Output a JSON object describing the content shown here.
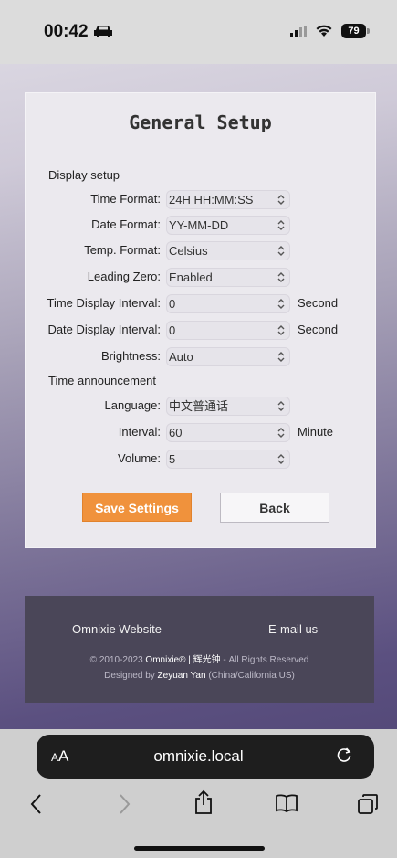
{
  "status_bar": {
    "time": "00:42",
    "battery": "79"
  },
  "panel": {
    "title": "General Setup",
    "display_section": "Display setup",
    "rows": [
      {
        "label": "Time Format:",
        "value": "24H HH:MM:SS",
        "unit": ""
      },
      {
        "label": "Date Format:",
        "value": "YY-MM-DD",
        "unit": ""
      },
      {
        "label": "Temp. Format:",
        "value": "Celsius",
        "unit": ""
      },
      {
        "label": "Leading Zero:",
        "value": "Enabled",
        "unit": ""
      },
      {
        "label": "Time Display Interval:",
        "value": "0",
        "unit": "Second"
      },
      {
        "label": "Date Display Interval:",
        "value": "0",
        "unit": "Second"
      },
      {
        "label": "Brightness:",
        "value": "Auto",
        "unit": ""
      }
    ],
    "announce_section": "Time announcement",
    "announce_rows": [
      {
        "label": "Language:",
        "value": "中文普通话",
        "unit": ""
      },
      {
        "label": "Interval:",
        "value": "60",
        "unit": "Minute"
      },
      {
        "label": "Volume:",
        "value": "5",
        "unit": ""
      }
    ],
    "save_label": "Save Settings",
    "back_label": "Back"
  },
  "footer": {
    "website_link": "Omnixie Website",
    "email_link": "E-mail us",
    "copyright_prefix": "© 2010-2023",
    "copyright_brand": "Omnixie® | 辉光钟",
    "copyright_suffix": "- All Rights Reserved",
    "designed_prefix": "Designed by",
    "designer": "Zeyuan Yan",
    "designer_suffix": "(China/California US)"
  },
  "browser": {
    "aa_label_small": "A",
    "aa_label_big": "A",
    "url": "omnixie.local"
  },
  "icons": {
    "status": [
      "car-icon",
      "signal-icon",
      "wifi-icon"
    ],
    "toolbar": [
      "back-icon",
      "forward-icon",
      "share-icon",
      "bookmarks-icon",
      "tabs-icon",
      "reload-icon"
    ]
  },
  "colors": {
    "save_button": "#f0923c",
    "footer_bg": "#4a4658",
    "panel_bg": "#ebe9ee"
  }
}
